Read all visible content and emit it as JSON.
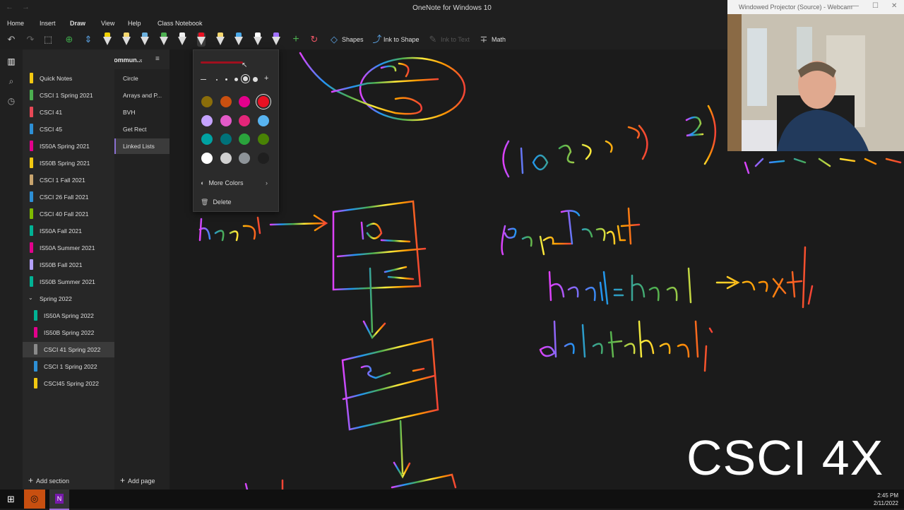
{
  "window": {
    "title": "OneNote for Windows 10"
  },
  "ribbon": {
    "tabs": [
      {
        "label": "Home"
      },
      {
        "label": "Insert"
      },
      {
        "label": "Draw"
      },
      {
        "label": "View"
      },
      {
        "label": "Help"
      },
      {
        "label": "Class Notebook"
      }
    ],
    "active_tab": "Draw",
    "tools": {
      "shapes_label": "Shapes",
      "ink_to_shape_label": "Ink to Shape",
      "ink_to_text_label": "Ink to Text",
      "math_label": "Math"
    },
    "pens": [
      {
        "color": "#f0d000"
      },
      {
        "color": "#f5d76e"
      },
      {
        "color": "#6ab0de"
      },
      {
        "color": "#4caf50"
      },
      {
        "color": "#f0f0f0"
      },
      {
        "color": "#e81123"
      },
      {
        "color": "#f5d76e"
      },
      {
        "color": "#4aa8e8"
      },
      {
        "color": "#ffffff"
      },
      {
        "color": "#a070ff"
      }
    ]
  },
  "notebook": {
    "name": "William @ State Center Commun..."
  },
  "sections": [
    {
      "label": "Quick Notes",
      "color": "#f2c811"
    },
    {
      "label": "CSCI 1 Spring 2021",
      "color": "#4caf50"
    },
    {
      "label": "CSCI 41",
      "color": "#e74856"
    },
    {
      "label": "CSCI 45",
      "color": "#2d8fd5"
    },
    {
      "label": "IS50A Spring 2021",
      "color": "#e3008c"
    },
    {
      "label": "IS50B Spring 2021",
      "color": "#f2c811"
    },
    {
      "label": "CSCI 1 Fall 2021",
      "color": "#c8a46e"
    },
    {
      "label": "CSCI 26 Fall 2021",
      "color": "#2d8fd5"
    },
    {
      "label": "CSCI 40 Fall 2021",
      "color": "#7fba00"
    },
    {
      "label": "IS50A Fall 2021",
      "color": "#00b294"
    },
    {
      "label": "IS50A Summer 2021",
      "color": "#e3008c"
    },
    {
      "label": "IS50B Fall 2021",
      "color": "#b4a0ff"
    },
    {
      "label": "IS50B Summer 2021",
      "color": "#00b294"
    }
  ],
  "section_group": {
    "label": "Spring 2022",
    "children": [
      {
        "label": "IS50A Spring 2022",
        "color": "#00b294"
      },
      {
        "label": "IS50B Spring 2022",
        "color": "#e3008c"
      },
      {
        "label": "CSCI 41 Spring 2022",
        "color": "#8a8a8a",
        "selected": true
      },
      {
        "label": "CSCI 1 Spring 2022",
        "color": "#2d8fd5"
      },
      {
        "label": "CSCI45 Spring 2022",
        "color": "#f2c811"
      }
    ]
  },
  "pages": [
    {
      "label": "Circle"
    },
    {
      "label": "Arrays and P..."
    },
    {
      "label": "BVH"
    },
    {
      "label": "Get Rect"
    },
    {
      "label": "Linked Lists",
      "selected": true
    }
  ],
  "footer": {
    "add_section": "Add section",
    "add_page": "Add page"
  },
  "color_popup": {
    "swatches": [
      "#8a6d0a",
      "#ca5010",
      "#e3008c",
      "#e81123",
      "#c5a3ff",
      "#e35ac8",
      "#e3267a",
      "#58b3f0",
      "#00a2a2",
      "#00727a",
      "#2aa33c",
      "#498205",
      "#ffffff",
      "#d0d0d0",
      "#8e9499",
      "#1f1f1f"
    ],
    "selected_swatch": 3,
    "more_colors": "More Colors",
    "delete": "Delete"
  },
  "webcam": {
    "title": "Windowed Projector (Source) - Webcam"
  },
  "watermark": "CSCI 4X",
  "taskbar": {
    "time": "2:45 PM",
    "date": "2/11/2022"
  }
}
